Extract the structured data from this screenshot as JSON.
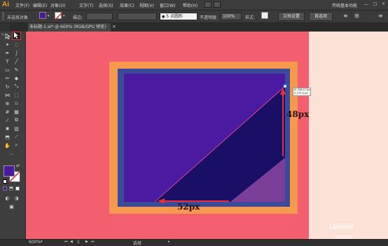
{
  "app": {
    "logo": "Ai",
    "workspace": "传统基本功能"
  },
  "menu": [
    "文件(F)",
    "编辑(E)",
    "对象(O)",
    "文字(T)",
    "选择(S)",
    "效果(C)",
    "视图(V)",
    "窗口(W)",
    "帮助(H)"
  ],
  "control_bar": {
    "selection_status": "未选择对象",
    "stroke_label": "描边:",
    "brush_label": "5 点圆形",
    "opacity_label": "不透明度:",
    "opacity_value": "100%",
    "style_label": "样式:",
    "doc_setup_button": "文档设置",
    "prefs_button": "首选项"
  },
  "document": {
    "tab_title": "未标题-1.ai* @ 600% (RGB/GPU 预览)",
    "close_glyph": "×"
  },
  "status": {
    "zoom": "600%",
    "page": "1",
    "tool": "选择"
  },
  "annotations": {
    "vertical": "48px",
    "horizontal": "52px",
    "readout_x": "X: 108.17 px",
    "readout_y": "Y: 271.3 px"
  },
  "watermark": {
    "brand": "UiiiUiii",
    "sub": "优优教程网"
  },
  "colors": {
    "canvas_bg": "#f45f6f",
    "artboard_orange": "#f5994e",
    "frame_blue": "#3b4b99",
    "square_purple": "#4a1ba0",
    "shadow_navy": "#1a0f66",
    "accent_light": "#7b3f9a",
    "fill_swatch": "#4a1ba0"
  },
  "icons": [
    "selection-tool-icon",
    "direct-selection-tool-icon",
    "magic-wand-icon",
    "lasso-icon",
    "pen-icon",
    "curvature-icon",
    "type-icon",
    "line-icon",
    "rectangle-icon",
    "paintbrush-icon",
    "pencil-icon",
    "eraser-icon",
    "rotate-icon",
    "scale-icon",
    "width-icon",
    "free-transform-icon",
    "shape-builder-icon",
    "perspective-icon",
    "mesh-icon",
    "gradient-icon",
    "eyedropper-icon",
    "blend-icon",
    "symbol-sprayer-icon",
    "graph-icon",
    "artboard-icon",
    "slice-icon",
    "hand-icon",
    "zoom-icon"
  ]
}
